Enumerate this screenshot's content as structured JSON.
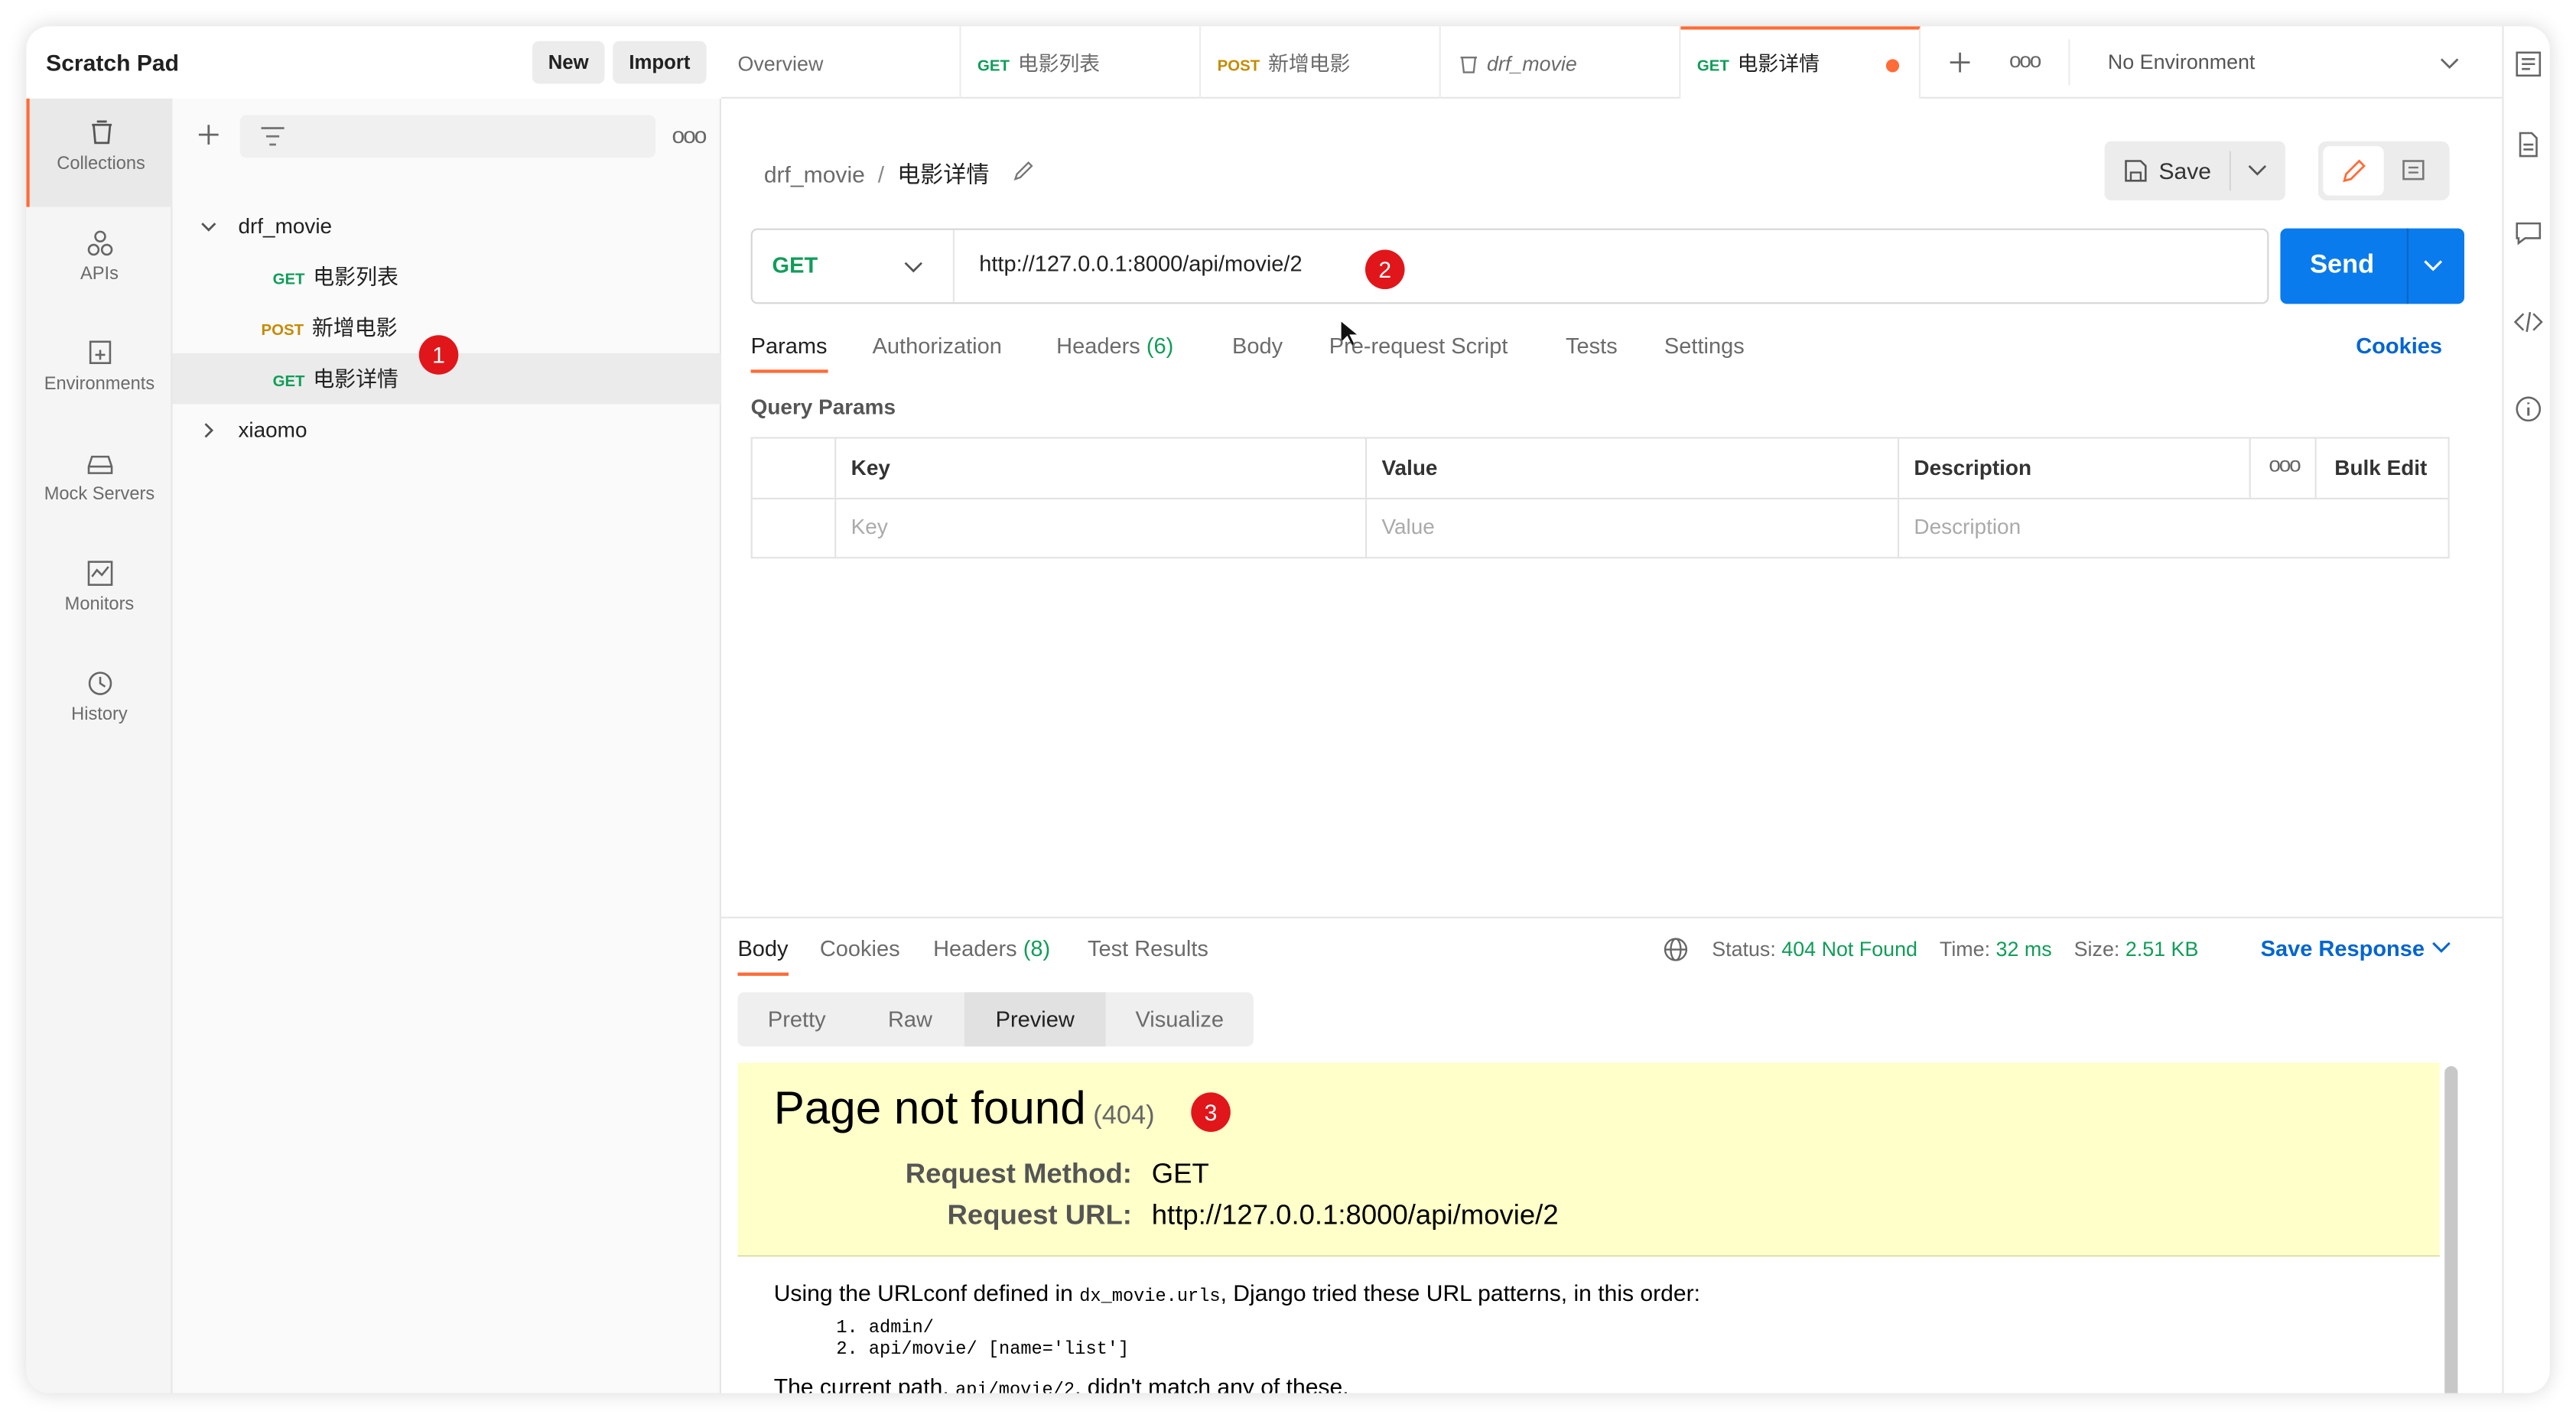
{
  "workspace": {
    "title": "Scratch Pad",
    "new_label": "New",
    "import_label": "Import"
  },
  "rail": [
    {
      "label": "Collections",
      "icon": "collections-icon",
      "active": true
    },
    {
      "label": "APIs",
      "icon": "apis-icon"
    },
    {
      "label": "Environments",
      "icon": "environments-icon"
    },
    {
      "label": "Mock Servers",
      "icon": "mock-servers-icon"
    },
    {
      "label": "Monitors",
      "icon": "monitors-icon"
    },
    {
      "label": "History",
      "icon": "history-icon"
    }
  ],
  "sidebar": {
    "collections": [
      {
        "name": "drf_movie",
        "expanded": true,
        "requests": [
          {
            "method": "GET",
            "name": "电影列表"
          },
          {
            "method": "POST",
            "name": "新增电影"
          },
          {
            "method": "GET",
            "name": "电影详情",
            "selected": true
          }
        ]
      },
      {
        "name": "xiaomo",
        "expanded": false
      }
    ]
  },
  "tabs": [
    {
      "label": "Overview"
    },
    {
      "method": "GET",
      "label": "电影列表"
    },
    {
      "method": "POST",
      "label": "新增电影"
    },
    {
      "label": "drf_movie",
      "icon": "collection-icon",
      "italic": true
    },
    {
      "method": "GET",
      "label": "电影详情",
      "active": true,
      "unsaved": true
    }
  ],
  "environment": {
    "label": "No Environment"
  },
  "breadcrumb": {
    "collection": "drf_movie",
    "separator": "/",
    "request": "电影详情"
  },
  "save_label": "Save",
  "request": {
    "method": "GET",
    "url": "http://127.0.0.1:8000/api/movie/2",
    "send_label": "Send",
    "tabs": [
      "Params",
      "Authorization",
      "Headers",
      "Body",
      "Pre-request Script",
      "Tests",
      "Settings"
    ],
    "headers_count": "(6)",
    "cookies_label": "Cookies",
    "query_params_title": "Query Params",
    "table": {
      "headers": [
        "Key",
        "Value",
        "Description"
      ],
      "bulk_edit": "Bulk Edit",
      "placeholders": [
        "Key",
        "Value",
        "Description"
      ]
    }
  },
  "response": {
    "tabs": [
      "Body",
      "Cookies",
      "Headers",
      "Test Results"
    ],
    "headers_count": "(8)",
    "status_label": "Status:",
    "status_value": "404 Not Found",
    "time_label": "Time:",
    "time_value": "32 ms",
    "size_label": "Size:",
    "size_value": "2.51 KB",
    "save_response": "Save Response",
    "view_modes": [
      "Pretty",
      "Raw",
      "Preview",
      "Visualize"
    ],
    "active_view": "Preview",
    "preview": {
      "title": "Page not found",
      "code": "(404)",
      "method_label": "Request Method:",
      "method_value": "GET",
      "url_label": "Request URL:",
      "url_value": "http://127.0.0.1:8000/api/movie/2",
      "urlconf_text_1": "Using the URLconf defined in",
      "urlconf_module": "dx_movie.urls",
      "urlconf_text_2": ", Django tried these URL patterns, in this order:",
      "patterns": [
        "1. admin/",
        "2. api/movie/ [name='list']"
      ],
      "current_text_1": "The current path,",
      "current_path": "api/movie/2",
      "current_text_2": ", didn't match any of these."
    }
  },
  "annotations": [
    "1",
    "2",
    "3"
  ],
  "colors": {
    "accent": "#ff6c37",
    "send": "#097bed",
    "get": "#0f9d58",
    "post": "#c58b00",
    "link": "#0265d2",
    "badge": "#e0161b"
  }
}
